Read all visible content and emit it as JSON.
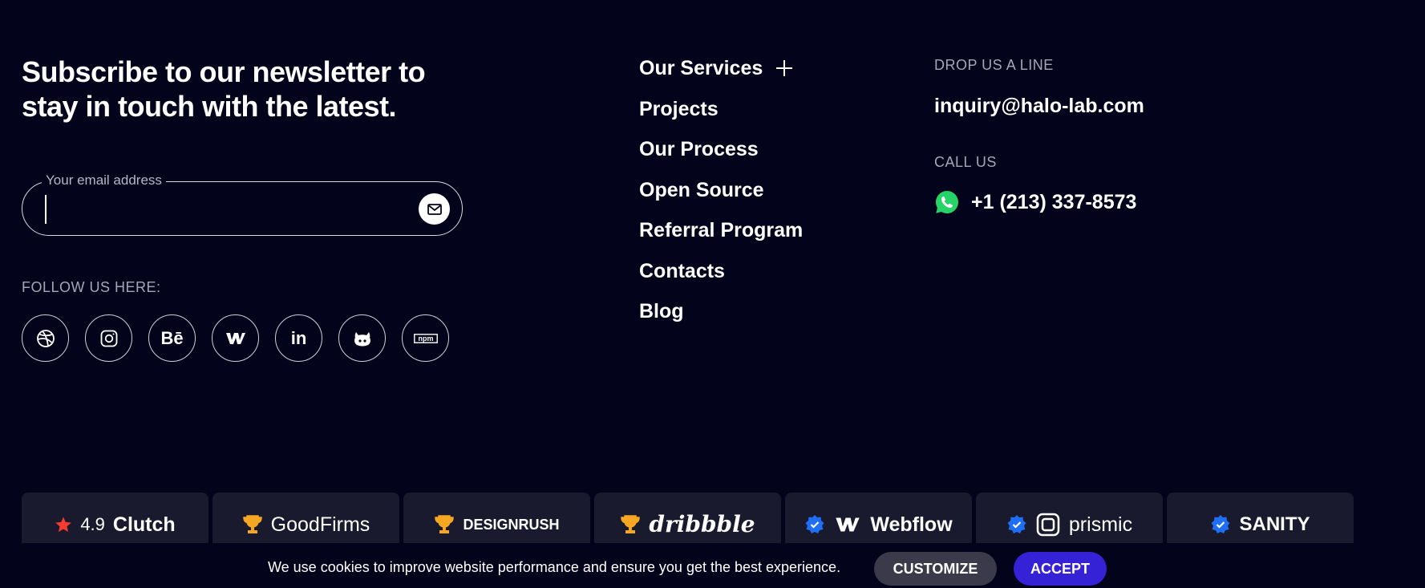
{
  "newsletter": {
    "title": "Subscribe to our newsletter to stay in touch with the latest.",
    "email_label": "Your email address",
    "email_value": "",
    "send_icon": "mail-icon"
  },
  "social": {
    "label": "FOLLOW US HERE:",
    "items": [
      {
        "name": "dribbble",
        "icon": "dribbble-icon"
      },
      {
        "name": "instagram",
        "icon": "instagram-icon"
      },
      {
        "name": "behance",
        "icon": "behance-icon",
        "text": "Bē"
      },
      {
        "name": "webflow",
        "icon": "webflow-icon"
      },
      {
        "name": "linkedin",
        "icon": "linkedin-icon",
        "text": "in"
      },
      {
        "name": "github",
        "icon": "github-icon"
      },
      {
        "name": "npm",
        "icon": "npm-icon",
        "text": "npm"
      }
    ]
  },
  "nav": {
    "items": [
      {
        "label": "Our Services",
        "expandable": true
      },
      {
        "label": "Projects"
      },
      {
        "label": "Our Process"
      },
      {
        "label": "Open Source"
      },
      {
        "label": "Referral Program"
      },
      {
        "label": "Contacts"
      },
      {
        "label": "Blog"
      }
    ]
  },
  "contact": {
    "email_label": "DROP US A LINE",
    "email": "inquiry@halo-lab.com",
    "phone_label": "CALL US",
    "phone": "+1 (213) 337-8573"
  },
  "badges": [
    {
      "icon": "star-icon",
      "rating": "4.9",
      "name": "Clutch"
    },
    {
      "icon": "trophy-icon",
      "name": "GoodFirms"
    },
    {
      "icon": "trophy-icon",
      "name": "DESIGNRUSH"
    },
    {
      "icon": "trophy-icon",
      "name": "dribbble"
    },
    {
      "icon": "verified-icon",
      "name": "Webflow"
    },
    {
      "icon": "verified-icon",
      "name": "prismic"
    },
    {
      "icon": "verified-icon",
      "name": "SANITY"
    }
  ],
  "cookie": {
    "text": "We use cookies to improve website performance and ensure you get the best experience.",
    "customize": "CUSTOMIZE",
    "accept": "ACCEPT"
  },
  "colors": {
    "background": "#04031c",
    "accent": "#3622d6",
    "badge_bg": "#1a1a2e",
    "trophy": "#f5a623",
    "verified": "#1e6ff5",
    "star": "#f53b2f",
    "whatsapp": "#25d366"
  }
}
